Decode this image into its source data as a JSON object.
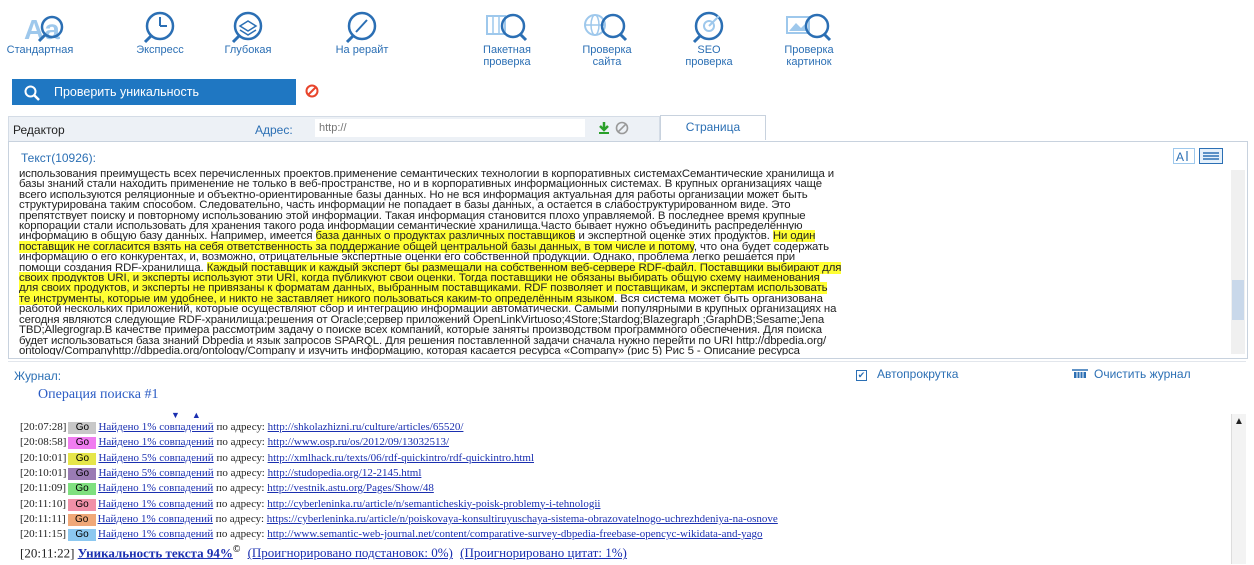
{
  "toolbar": {
    "standard": "Стандартная",
    "express": "Экспресс",
    "deep": "Глубокая",
    "rewrite": "На рерайт",
    "batch": "Пакетная\nпроверка",
    "site": "Проверка\nсайта",
    "seo": "SEO\nпроверка",
    "images": "Проверка\nкартинок"
  },
  "check_button": "Проверить уникальность",
  "editor": {
    "tab_label": "Редактор",
    "address_label": "Адрес:",
    "url_placeholder": "http://",
    "page_tab": "Страница"
  },
  "text_panel": {
    "count_label": "Текст(10926):",
    "lines": [
      [
        {
          "t": "использования преимущесть всех перечисленных проектов.применение семантических технологии в корпоративных системахСемантические хранилища и"
        }
      ],
      [
        {
          "t": "базы знаний стали находить применение не только в веб-пространстве, но и в корпоративных информационных системах. В крупных организациях чаще"
        }
      ],
      [
        {
          "t": "всего используются реляционные и объектно-ориентированные базы данных. Но не вся информация актуальная для работы организации может быть"
        }
      ],
      [
        {
          "t": "структурирована таким способом. Следовательно, часть информации не попадает в базы данных, а остается в слабоструктурированном виде. Это"
        }
      ],
      [
        {
          "t": "препятствует поиску и повторному использованию этой информации. Такая информация становится плохо управляемой. В последнее время крупные"
        }
      ],
      [
        {
          "t": "корпорации стали использовать для хранения такого рода информации семантические хранилища.Часто бывает нужно объединить распределённую"
        }
      ],
      [
        {
          "t": "информацию в общую базу данных. Например,  имеется "
        },
        {
          "t": "база данных о продуктах различных поставщиков",
          "h": true
        },
        {
          "t": " и экспертной оценке этих продуктов. "
        },
        {
          "t": "Ни один",
          "h": true
        }
      ],
      [
        {
          "t": "поставщик не согласится взять на себя ответственность за поддержание общей центральной базы данных, в том числе и потому",
          "h": true
        },
        {
          "t": ", что она будет содержать"
        }
      ],
      [
        {
          "t": "информацию о его конкурентах, и, возможно, отрицательные экспертные оценки его собственной продукции. Однако, проблема легко решается при"
        }
      ],
      [
        {
          "t": "помощи создания RDF-хранилища. "
        },
        {
          "t": "Каждый поставщик и каждый эксперт бы размещали на собственном веб-сервере RDF-файл. Поставщики выбирают для",
          "h": true
        }
      ],
      [
        {
          "t": "своих продуктов URI, и эксперты используют эти URI, когда публикуют свои оценки. Тогда поставщики не обязаны выбирать общую схему наименования",
          "h": true
        }
      ],
      [
        {
          "t": "для своих продуктов, и эксперты не привязаны к форматам данных, выбранным поставщиками. RDF позволяет и поставщикам, и экспертам использовать",
          "h": true
        }
      ],
      [
        {
          "t": "те инструменты, которые им удобнее, и никто не заставляет никого пользоваться каким-то определённым языком",
          "h": true
        },
        {
          "t": ". Вся система может быть организована"
        }
      ],
      [
        {
          "t": "работой нескольких приложений, которые осуществляют сбор и интеграцию информации автоматически. Самыми популярными в крупных организациях на"
        }
      ],
      [
        {
          "t": "сегодня являются следующие RDF-хранилища:решения от Oracle;сервер приложений OpenLinkVirtuoso;4Store;Stardog;Blazegraph ;GraphDB;Sesame;Jena"
        }
      ],
      [
        {
          "t": "TBD;Allegrograp.В качестве примера рассмотрим задачу о поиске всех компаний, которые заняты производством программного обеспечения. Для поиска"
        }
      ],
      [
        {
          "t": "будет использоваться база знаний Dbpedia и язык запросов SPARQL. Для решения поставленной задачи сначала нужно перейти по URI http://dbpedia.org/"
        }
      ],
      [
        {
          "t": "ontology/Companyhttp://dbpedia.org/ontology/Company и изучить информацию, которая касается ресурса «Company» (рис 5) Рис 5 - Описание ресурса"
        }
      ]
    ]
  },
  "log": {
    "label": "Журнал:",
    "autoscroll": "Автопрокрутка",
    "clear": "Очистить журнал",
    "operation_title": "Операция поиска #1",
    "go_label": "Go",
    "by_address": "по адресу:",
    "rows": [
      {
        "time": "[20:07:28]",
        "color": "#c8c8c8",
        "found": "Найдено 1% совпадений",
        "url": "http://shkolazhizni.ru/culture/articles/65520/"
      },
      {
        "time": "[20:08:58]",
        "color": "#f07cf0",
        "found": "Найдено 1% совпадений",
        "url": "http://www.osp.ru/os/2012/09/13032513/"
      },
      {
        "time": "[20:10:01]",
        "color": "#e6e64a",
        "found": "Найдено 5% совпадений",
        "url": "http://xmlhack.ru/texts/06/rdf-quickintro/rdf-quickintro.html"
      },
      {
        "time": "[20:10:01]",
        "color": "#9a7bb4",
        "found": "Найдено 5% совпадений",
        "url": "http://studopedia.org/12-2145.html"
      },
      {
        "time": "[20:11:09]",
        "color": "#7fe07f",
        "found": "Найдено 1% совпадений",
        "url": "http://vestnik.astu.org/Pages/Show/48"
      },
      {
        "time": "[20:11:10]",
        "color": "#f090a8",
        "found": "Найдено 1% совпадений",
        "url": "http://cyberleninka.ru/article/n/semanticheskiy-poisk-problemy-i-tehnologii"
      },
      {
        "time": "[20:11:11]",
        "color": "#f0a878",
        "found": "Найдено 1% совпадений",
        "url": "https://cyberleninka.ru/article/n/poiskovaya-konsultiruyuschaya-sistema-obrazovatelnogo-uchrezhdeniya-na-osnove"
      },
      {
        "time": "[20:11:15]",
        "color": "#8cc8f0",
        "found": "Найдено 1% совпадений",
        "url": "http://www.semantic-web-journal.net/content/comparative-survey-dbpedia-freebase-opencyc-wikidata-and-yago"
      }
    ],
    "result_time": "[20:11:22]",
    "uniqueness": "Уникальность текста 94%",
    "copyright": "©",
    "ignored_subs": "(Проигнорировано подстановок: 0%)",
    "ignored_quotes": "(Проигнорировано цитат: 1%)"
  }
}
